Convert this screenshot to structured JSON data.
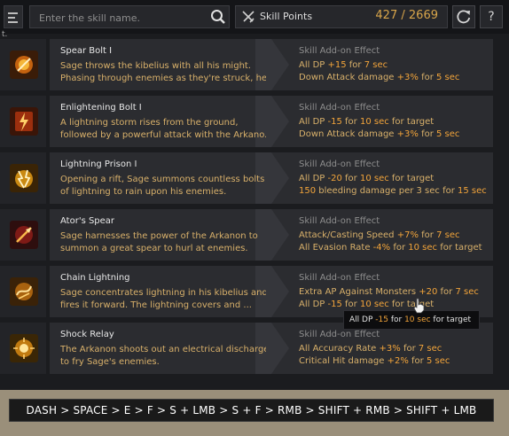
{
  "toolbar": {
    "search_placeholder": "Enter the skill name.",
    "skill_points_label": "Skill Points",
    "skill_points_used": "427",
    "skill_points_separator": "/",
    "skill_points_total": "2669",
    "help_label": "?",
    "corner_mark": "t."
  },
  "skills": [
    {
      "name": "Spear Bolt I",
      "desc_1": "Sage throws the kibelius with all his might.",
      "desc_2": "Phasing through enemies as they're struck, he ...",
      "effect_title": "Skill Add-on Effect",
      "effects": [
        {
          "pre": "All DP ",
          "v1": "+15",
          "mid": " for ",
          "v2": "7 sec",
          "post": ""
        },
        {
          "pre": "Down Attack damage ",
          "v1": "+3%",
          "mid": " for ",
          "v2": "5 sec",
          "post": ""
        }
      ],
      "icon": "spear-bolt-icon"
    },
    {
      "name": "Enlightening Bolt I",
      "desc_1": "A lightning storm rises from the ground,",
      "desc_2": "followed by a powerful attack with the Arkano...",
      "effect_title": "Skill Add-on Effect",
      "effects": [
        {
          "pre": "All DP ",
          "v1": "-15",
          "mid": " for ",
          "v2": "10 sec",
          "post": " for target"
        },
        {
          "pre": "Down Attack damage ",
          "v1": "+3%",
          "mid": " for ",
          "v2": "5 sec",
          "post": ""
        }
      ],
      "icon": "enlightening-bolt-icon"
    },
    {
      "name": "Lightning Prison I",
      "desc_1": "Opening a rift, Sage summons countless bolts",
      "desc_2": "of lightning to rain upon his enemies.",
      "effect_title": "Skill Add-on Effect",
      "effects": [
        {
          "pre": "All DP ",
          "v1": "-20",
          "mid": " for ",
          "v2": "10 sec",
          "post": " for target"
        },
        {
          "pre": "",
          "v1": "150",
          "mid": " bleeding damage per 3 sec for ",
          "v2": "15 sec",
          "post": ""
        }
      ],
      "icon": "lightning-prison-icon"
    },
    {
      "name": "Ator's Spear",
      "desc_1": "Sage harnesses the power of the Arkanon to",
      "desc_2": "summon a great spear to hurl at enemies.",
      "effect_title": "Skill Add-on Effect",
      "effects": [
        {
          "pre": "Attack/Casting Speed ",
          "v1": "+7%",
          "mid": " for ",
          "v2": "7 sec",
          "post": ""
        },
        {
          "pre": "All Evasion Rate ",
          "v1": "-4%",
          "mid": " for ",
          "v2": "10 sec",
          "post": " for target"
        }
      ],
      "icon": "ators-spear-icon"
    },
    {
      "name": "Chain Lightning",
      "desc_1": "Sage concentrates lightning in his kibelius and",
      "desc_2": "fires it forward. The lightning covers and ...",
      "effect_title": "Skill Add-on Effect",
      "effects": [
        {
          "pre": "Extra AP Against Monsters ",
          "v1": "+20",
          "mid": " for ",
          "v2": "7 sec",
          "post": ""
        },
        {
          "pre": "All DP ",
          "v1": "-15",
          "mid": " for ",
          "v2": "10 sec",
          "post": " for target"
        }
      ],
      "icon": "chain-lightning-icon"
    },
    {
      "name": "Shock Relay",
      "desc_1": "The Arkanon shoots out an electrical discharge",
      "desc_2": "to fry Sage's enemies.",
      "effect_title": "Skill Add-on Effect",
      "effects": [
        {
          "pre": "All Accuracy Rate ",
          "v1": "+3%",
          "mid": " for ",
          "v2": "7 sec",
          "post": ""
        },
        {
          "pre": "Critical Hit damage ",
          "v1": "+2%",
          "mid": " for ",
          "v2": "5 sec",
          "post": ""
        }
      ],
      "icon": "shock-relay-icon"
    }
  ],
  "tooltip": {
    "pre": "All DP ",
    "v1": "-15",
    "mid": " for ",
    "v2": "10 sec",
    "post": " for target"
  },
  "combo": "DASH > SPACE > E > F > S + LMB > S + F > RMB > SHIFT + RMB > SHIFT + LMB",
  "colors": {
    "accent": "#f2a43a",
    "desc": "#d8b06a",
    "points": "#d8a54a"
  }
}
